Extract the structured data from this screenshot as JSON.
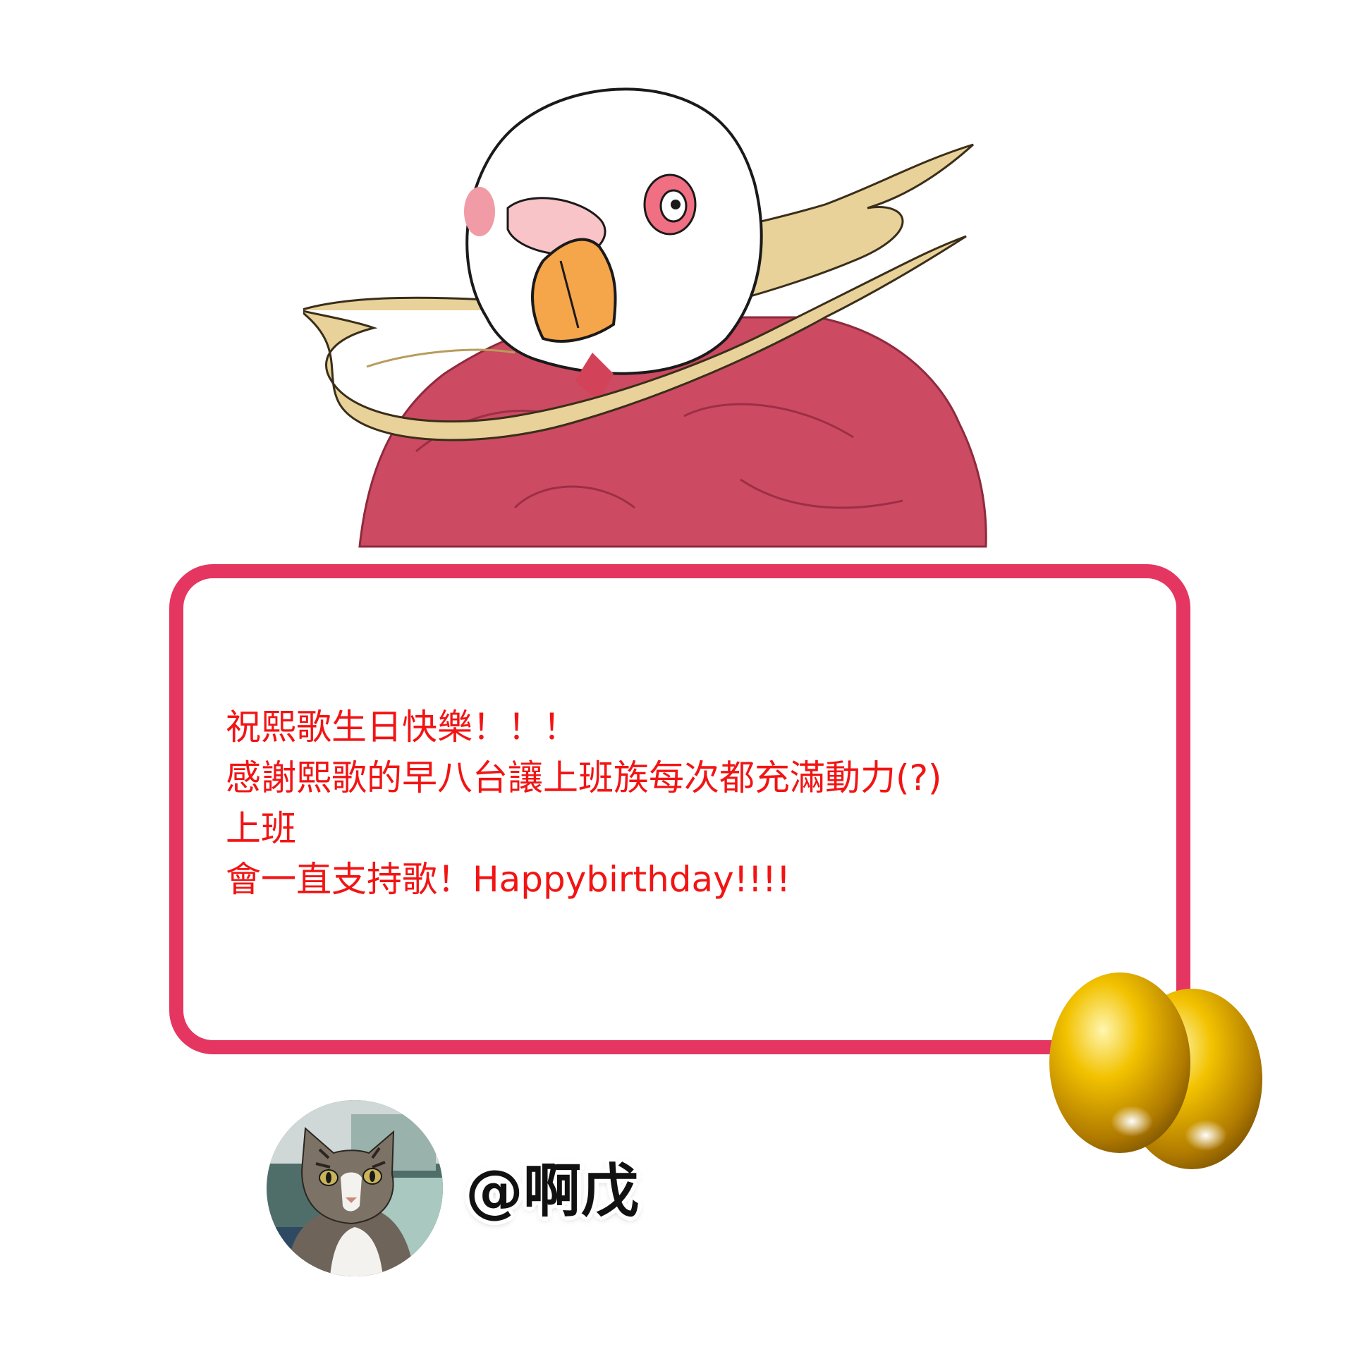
{
  "message": {
    "lines": [
      "祝熙歌生日快樂！！！",
      "感謝熙歌的早八台讓上班族每次都充滿動力(?)",
      "上班",
      "會一直支持歌！Happybirthday!!!!"
    ]
  },
  "author": {
    "handle": "@啊戊"
  },
  "colors": {
    "card_border": "#e43661",
    "message_text": "#f21414",
    "handle_text": "#111111",
    "hoodie": "#cc4a62",
    "halo": "#e8d29a",
    "beak": "#f5a54a",
    "egg_gold": "#f2c200"
  },
  "icons": {
    "illustration": "bird-character-icon",
    "eggs": "golden-eggs-icon",
    "avatar": "cat-avatar-icon"
  }
}
